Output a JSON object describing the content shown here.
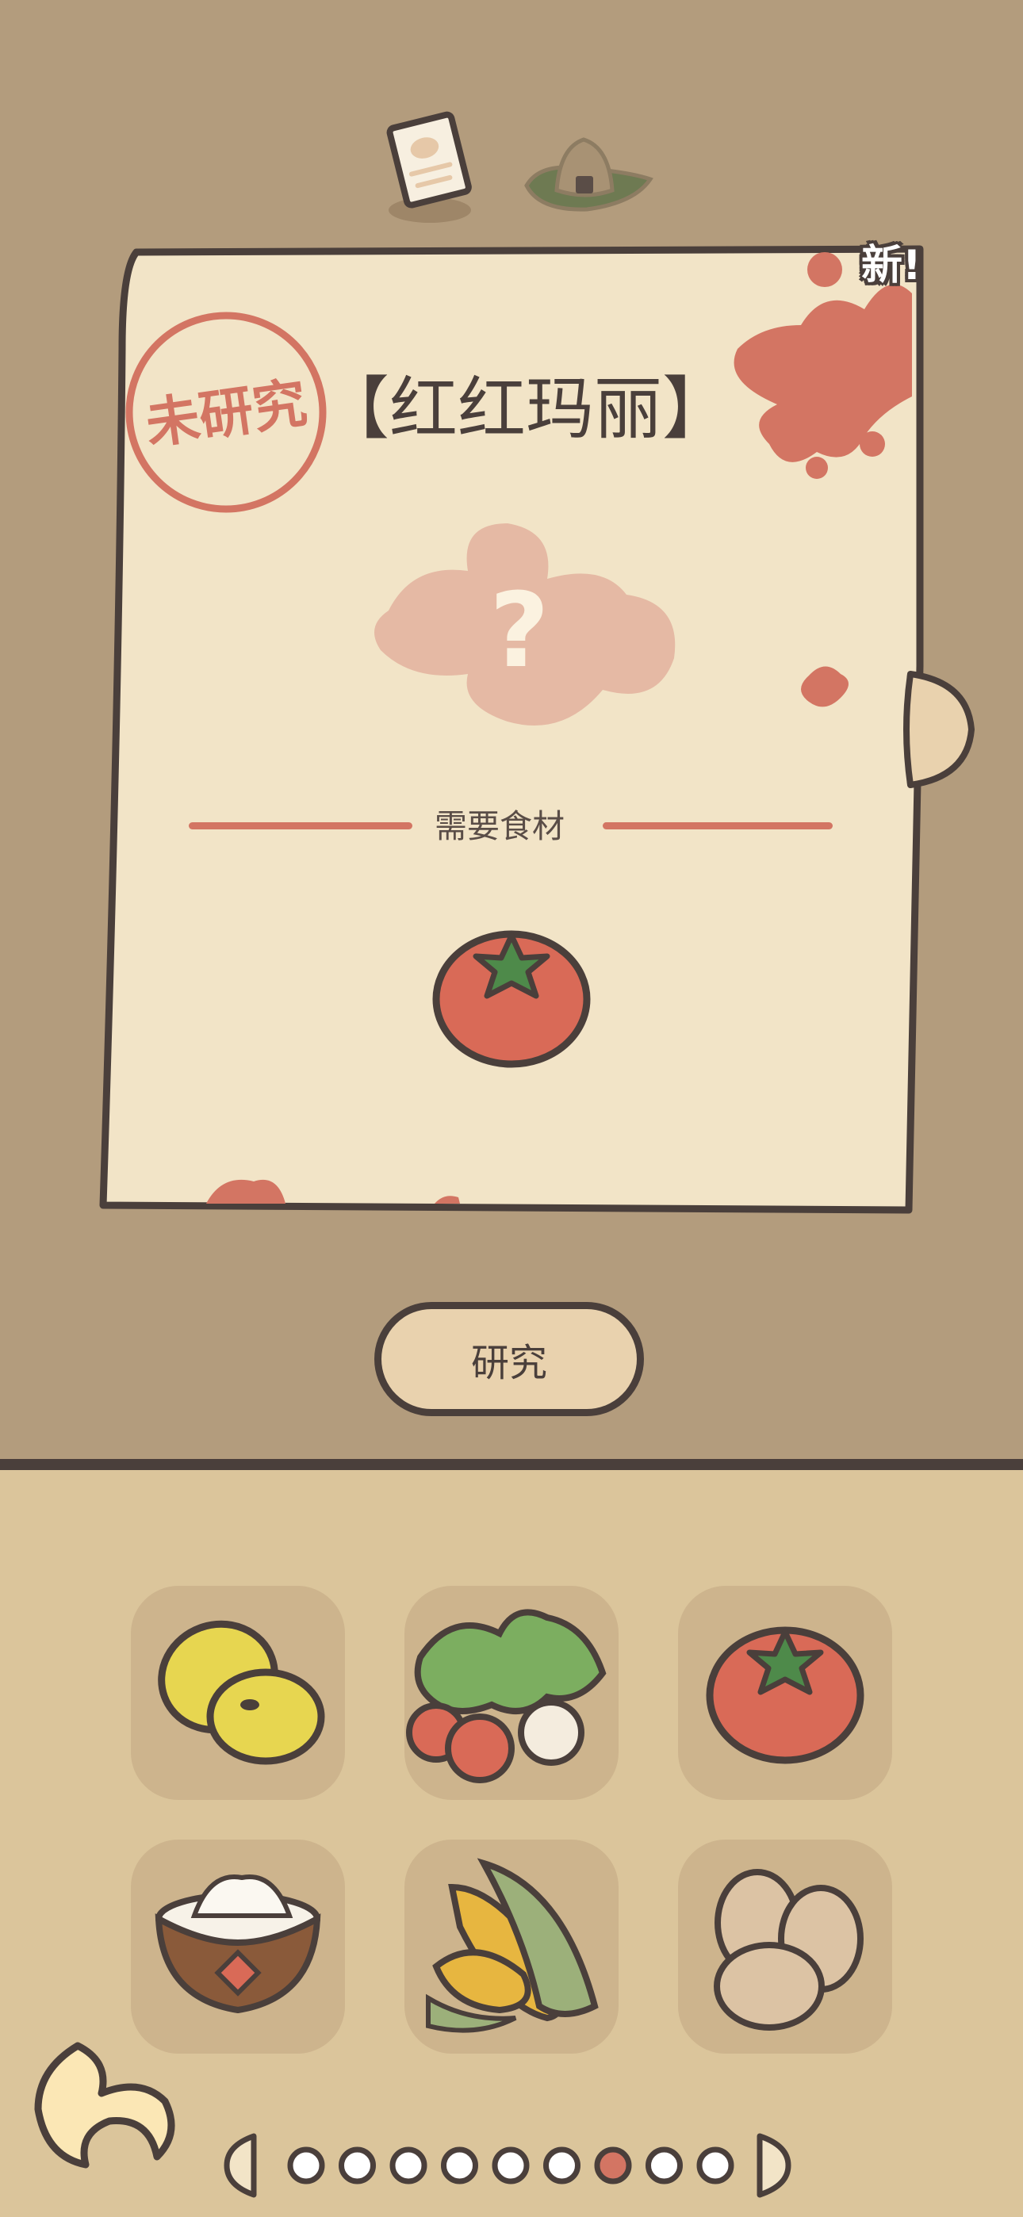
{
  "recipe": {
    "status_stamp": "未研究",
    "title": "【红红玛丽】",
    "new_badge": "新!",
    "ingredients_label": "需要食材",
    "required_ingredients": [
      "tomato-icon"
    ],
    "preview_icon": "question-mark-icon"
  },
  "research_button": {
    "label": "研究"
  },
  "top_tabs": [
    {
      "name": "recipe-note-icon",
      "active": true
    },
    {
      "name": "onigiri-icon",
      "active": false
    }
  ],
  "inventory": {
    "items": [
      "lemon-icon",
      "radish-icon",
      "tomato-icon",
      "flour-bowl-icon",
      "corn-icon",
      "egg-icon"
    ]
  },
  "pagination": {
    "total": 9,
    "current": 7
  },
  "colors": {
    "background": "#b39c7d",
    "panel": "#dbc59b",
    "paper": "#f2e4c7",
    "outline": "#4a3f3b",
    "stamp_red": "#d37563",
    "tomato_red": "#d96a57"
  }
}
